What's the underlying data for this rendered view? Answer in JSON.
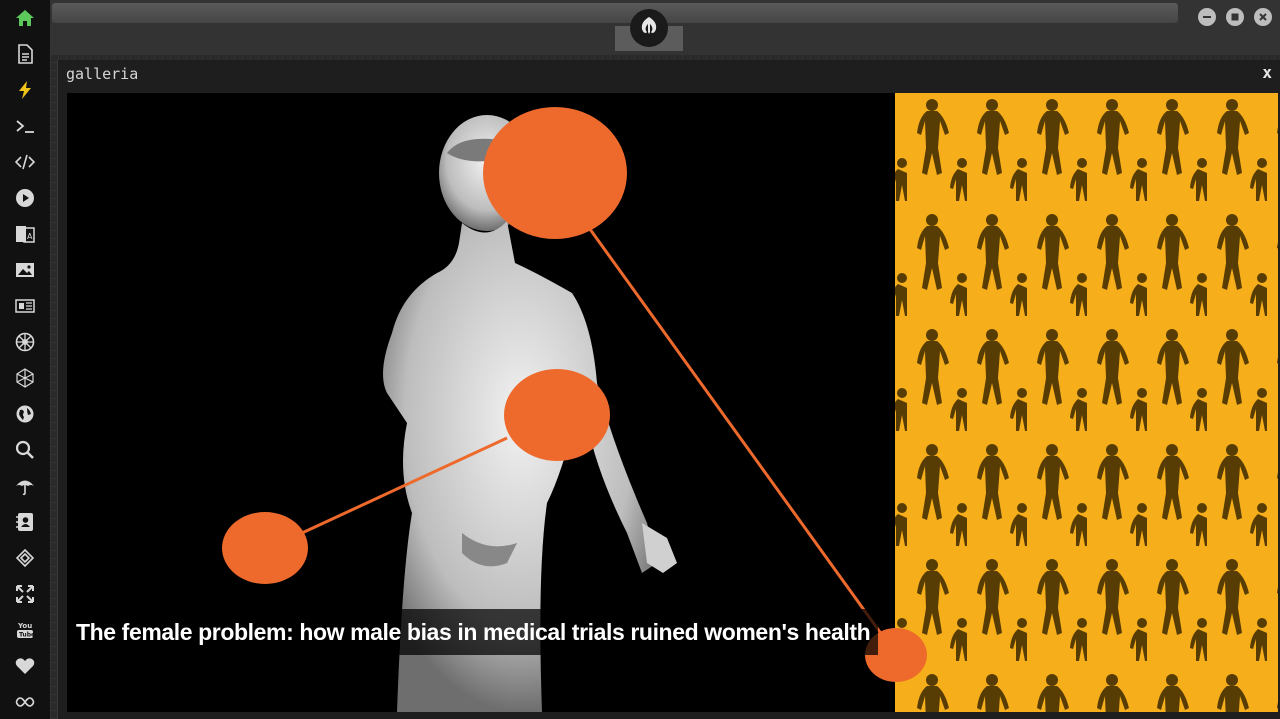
{
  "topbar": {
    "logo": "rebel-alliance-icon",
    "window_buttons": [
      "minimize-icon",
      "maximize-icon",
      "close-icon"
    ]
  },
  "sidebar": {
    "items": [
      {
        "icon": "home-icon",
        "color": "#5cc85c"
      },
      {
        "icon": "document-icon"
      },
      {
        "icon": "lightning-icon",
        "color": "#f0c419"
      },
      {
        "icon": "terminal-icon"
      },
      {
        "icon": "code-icon"
      },
      {
        "icon": "play-icon"
      },
      {
        "icon": "translate-icon"
      },
      {
        "icon": "image-icon"
      },
      {
        "icon": "news-icon"
      },
      {
        "icon": "empire-icon"
      },
      {
        "icon": "network-icon"
      },
      {
        "icon": "globe-icon"
      },
      {
        "icon": "search-icon"
      },
      {
        "icon": "umbrella-icon"
      },
      {
        "icon": "contacts-icon"
      },
      {
        "icon": "codepen-icon"
      },
      {
        "icon": "fullscreen-icon"
      },
      {
        "icon": "youtube-icon"
      },
      {
        "icon": "heart-icon"
      },
      {
        "icon": "infinity-icon"
      }
    ]
  },
  "gallery": {
    "title": "galleria",
    "close_label": "x",
    "caption": "The female problem: how male bias in medical trials ruined women's health",
    "accent_color": "#ee6a2c",
    "panel_color": "#f6ae1a"
  }
}
